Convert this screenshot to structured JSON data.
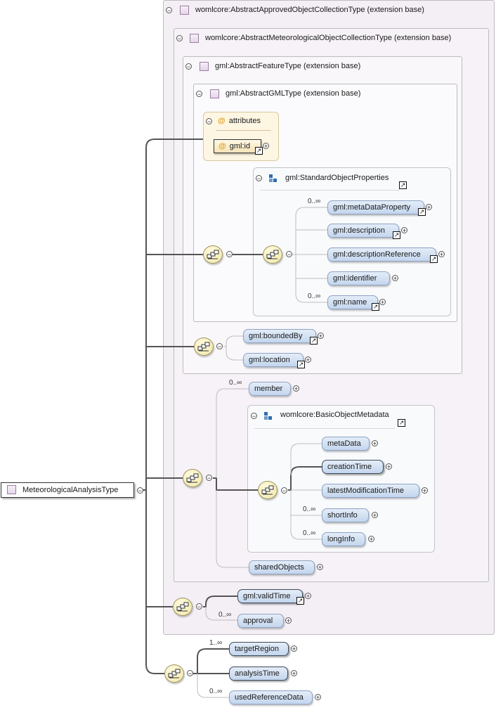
{
  "root": {
    "label": "MeteorologicalAnalysisType"
  },
  "ext": {
    "approved": "womlcore:AbstractApprovedObjectCollectionType (extension base)",
    "meteo": "womlcore:AbstractMeteorologicalObjectCollectionType (extension base)",
    "feature": "gml:AbstractFeatureType (extension base)",
    "gml": "gml:AbstractGMLType (extension base)"
  },
  "attributes": {
    "title": "attributes",
    "at": "@",
    "id": "gml:id"
  },
  "std_props": {
    "title": "gml:StandardObjectProperties",
    "items": [
      {
        "label": "gml:metaDataProperty",
        "card": "0..∞"
      },
      {
        "label": "gml:description",
        "card": ""
      },
      {
        "label": "gml:descriptionReference",
        "card": ""
      },
      {
        "label": "gml:identifier",
        "card": ""
      },
      {
        "label": "gml:name",
        "card": "0..∞"
      }
    ]
  },
  "feature_seq": {
    "items": [
      "gml:boundedBy",
      "gml:location"
    ]
  },
  "member": {
    "label": "member",
    "card": "0..∞"
  },
  "basic_meta": {
    "title": "womlcore:BasicObjectMetadata",
    "items": [
      {
        "label": "metaData",
        "card": ""
      },
      {
        "label": "creationTime",
        "card": ""
      },
      {
        "label": "latestModificationTime",
        "card": ""
      },
      {
        "label": "shortInfo",
        "card": "0..∞"
      },
      {
        "label": "longInfo",
        "card": "0..∞"
      }
    ]
  },
  "shared": {
    "label": "sharedObjects"
  },
  "valid_seq": [
    {
      "label": "gml:validTime",
      "card": ""
    },
    {
      "label": "approval",
      "card": "0..∞"
    }
  ],
  "final_seq": [
    {
      "label": "targetRegion",
      "card": "1..∞"
    },
    {
      "label": "analysisTime",
      "card": ""
    },
    {
      "label": "usedReferenceData",
      "card": "0..∞"
    }
  ],
  "symbols": {
    "minus": "−",
    "plus": "+",
    "ref": "↗"
  },
  "colors": {
    "element_fill": "#c4d6ee",
    "extension_fill": "#f4eef5",
    "attribute_fill": "#fdf6e3",
    "sequence_fill": "#f0e6a6"
  }
}
